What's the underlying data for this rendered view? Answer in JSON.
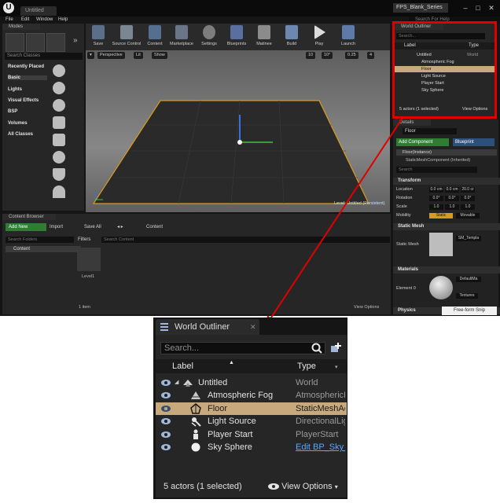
{
  "editor": {
    "document_tab": "Untitled",
    "project_tab": "FPS_Blank_Series",
    "menu": [
      "File",
      "Edit",
      "Window",
      "Help"
    ],
    "help_search": "Search For Help",
    "modes": {
      "tab": "Modes",
      "search_placeholder": "Search Classes",
      "categories": [
        "Recently Placed",
        "Basic",
        "Lights",
        "Visual Effects",
        "BSP",
        "Volumes",
        "All Classes"
      ]
    },
    "toolbar": [
      "Save",
      "Source Control",
      "Content",
      "Marketplace",
      "Settings",
      "Blueprints",
      "Matinee",
      "Build",
      "Play",
      "Launch"
    ],
    "viewport": {
      "perspective": "Perspective",
      "lit": "Lit",
      "show": "Show",
      "grid_snap": "10",
      "angle_snap": "10°",
      "scale_snap": "0.25",
      "camera_speed": "4",
      "level_label": "Level:",
      "level_name": "Untitled (Persistent)"
    },
    "content_browser": {
      "tab": "Content Browser",
      "add_new": "Add New",
      "import": "Import",
      "save_all": "Save All",
      "path": "Content",
      "search_folders": "Search Folders",
      "filters": "Filters",
      "search_content": "Search Content",
      "folder": "Content",
      "asset": "Level1",
      "item_count": "1 item",
      "view_options": "View Options"
    },
    "details": {
      "tab": "Details",
      "name": "Floor",
      "add_component": "Add Component",
      "blueprint": "Blueprint",
      "instance": "Floor(Instance)",
      "component": "StaticMeshComponent (Inherited)",
      "search": "Search",
      "transform": "Transform",
      "location": "Location",
      "rotation": "Rotation",
      "scale": "Scale",
      "mobility": "Mobility",
      "loc_vals": [
        "0.0 cm",
        "0.0 cm",
        "20.0 cr"
      ],
      "rot_vals": [
        "0.0°",
        "0.0°",
        "0.0°"
      ],
      "scale_vals": [
        "1.0",
        "1.0",
        "1.0"
      ],
      "mob_static": "Static",
      "mob_movable": "Movable",
      "static_mesh_section": "Static Mesh",
      "static_mesh_label": "Static Mesh",
      "static_mesh_value": "SM_Templa",
      "materials_section": "Materials",
      "element0_label": "Element 0",
      "element0_value": "DefaultMa",
      "textures": "Textures",
      "physics_section": "Physics"
    },
    "snip_label": "Free-form Snip"
  },
  "outliner": {
    "tab": "World Outliner",
    "search_placeholder": "Search...",
    "col_label": "Label",
    "col_type": "Type",
    "rows": [
      {
        "label": "Untitled",
        "type": "World",
        "selected": false,
        "icon": "world-icon"
      },
      {
        "label": "Atmospheric Fog",
        "type": "AtmosphericFog",
        "selected": false,
        "icon": "fog-icon"
      },
      {
        "label": "Floor",
        "type": "StaticMeshActor",
        "selected": true,
        "icon": "static-mesh-icon"
      },
      {
        "label": "Light Source",
        "type": "DirectionalLight",
        "selected": false,
        "icon": "directional-light-icon"
      },
      {
        "label": "Player Start",
        "type": "PlayerStart",
        "selected": false,
        "icon": "player-start-icon"
      },
      {
        "label": "Sky Sphere",
        "type": "Edit BP_Sky_Sphere",
        "selected": false,
        "icon": "sky-sphere-icon"
      }
    ],
    "footer_count": "5 actors (1 selected)",
    "view_options": "View Options"
  },
  "colors": {
    "highlight_border": "#e00000",
    "selection": "#c8a97e",
    "link": "#5aa8ff",
    "add_green": "#2e7d32"
  }
}
